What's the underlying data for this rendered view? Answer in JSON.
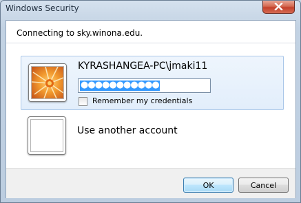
{
  "window": {
    "title": "Windows Security",
    "close_icon": "close-icon"
  },
  "connection": {
    "message": "Connecting to sky.winona.edu."
  },
  "account": {
    "user_name": "KYRASHANGEA-PC\\jmaki11",
    "password_masked": "●●●●●●●●●●●",
    "avatar_icon": "orange-flower-avatar-icon",
    "remember_label": "Remember my credentials",
    "remember_checked": false
  },
  "other_account": {
    "label": "Use another account",
    "avatar_icon": "blank-avatar-icon"
  },
  "buttons": {
    "ok_label": "OK",
    "cancel_label": "Cancel"
  },
  "colors": {
    "selection_blue": "#3399ff",
    "selected_tile_bg": "#e2eefb",
    "close_red": "#c4402a"
  }
}
